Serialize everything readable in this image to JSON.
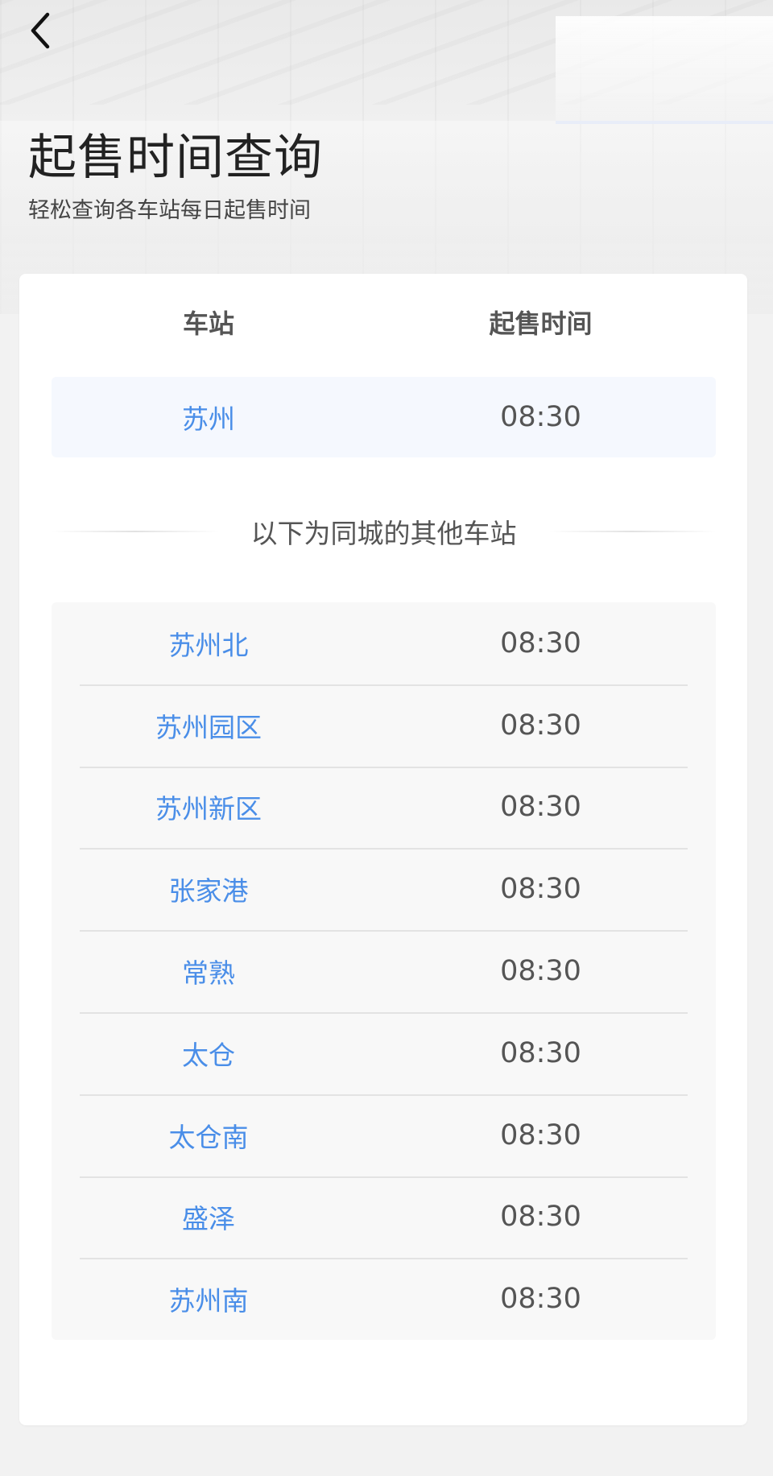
{
  "header": {
    "title": "起售时间查询",
    "subtitle": "轻松查询各车站每日起售时间"
  },
  "table": {
    "col_station": "车站",
    "col_time": "起售时间"
  },
  "main_station": {
    "station": "苏州",
    "time": "08:30"
  },
  "divider_text": "以下为同城的其他车站",
  "other_stations": [
    {
      "station": "苏州北",
      "time": "08:30"
    },
    {
      "station": "苏州园区",
      "time": "08:30"
    },
    {
      "station": "苏州新区",
      "time": "08:30"
    },
    {
      "station": "张家港",
      "time": "08:30"
    },
    {
      "station": "常熟",
      "time": "08:30"
    },
    {
      "station": "太仓",
      "time": "08:30"
    },
    {
      "station": "太仓南",
      "time": "08:30"
    },
    {
      "station": "盛泽",
      "time": "08:30"
    },
    {
      "station": "苏州南",
      "time": "08:30"
    }
  ],
  "colors": {
    "station_link": "#4a8ee8",
    "highlight_row": "#f5f8fe",
    "list_background": "#f8f8f8"
  }
}
